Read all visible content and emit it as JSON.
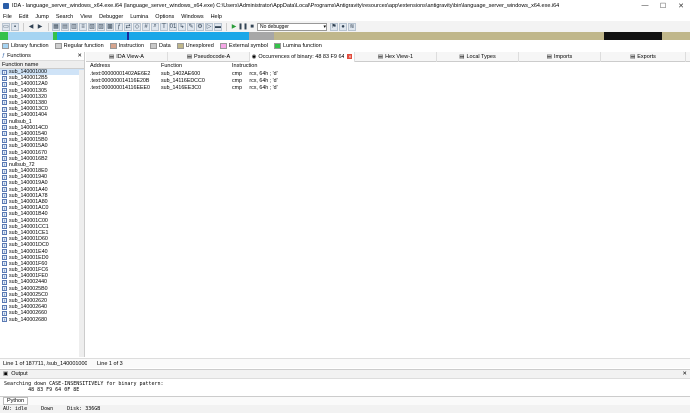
{
  "window": {
    "title": "IDA - language_server_windows_x64.exe.i64 (language_server_windows_x64.exe) C:\\Users\\Administrator\\AppData\\Local\\Programs\\Antigravity\\resources\\app\\extensions\\antigravity\\bin\\language_server_windows_x64.exe.i64",
    "minimize": "—",
    "maximize": "☐",
    "close": "✕"
  },
  "menu": [
    "File",
    "Edit",
    "Jump",
    "Search",
    "View",
    "Debugger",
    "Lumina",
    "Options",
    "Windows",
    "Help"
  ],
  "toolbar": {
    "debugger_select": "No debugger"
  },
  "legend": [
    {
      "label": "Library function",
      "color": "#a6d4f2"
    },
    {
      "label": "Regular function",
      "color": "#cfcfcf"
    },
    {
      "label": "Instruction",
      "color": "#d6a58f"
    },
    {
      "label": "Data",
      "color": "#c8c8c8"
    },
    {
      "label": "Unexplored",
      "color": "#c0b78b"
    },
    {
      "label": "External symbol",
      "color": "#f5a7e6"
    },
    {
      "label": "Lumina function",
      "color": "#35c14a"
    }
  ],
  "functions_pane": {
    "title": "Functions",
    "close": "✕",
    "column": "Function name",
    "icon": "f",
    "items": [
      "sub_140001000",
      "sub_1400012B5",
      "sub_1400012A0",
      "sub_140001305",
      "sub_140001320",
      "sub_140001380",
      "sub_1400013C0",
      "sub_140001404",
      "nullsub_1",
      "sub_1400014C0",
      "sub_140001540",
      "sub_1400015B0",
      "sub_1400015A0",
      "sub_140001670",
      "sub_1400016B2",
      "nullsub_72",
      "sub_1400018E0",
      "sub_140001940",
      "sub_1400019A0",
      "sub_140001A40",
      "sub_140001A78",
      "sub_140001A80",
      "sub_140001AC0",
      "sub_140001B40",
      "sub_140001C00",
      "sub_140001CC1",
      "sub_140001CE1",
      "sub_140001D60",
      "sub_140001DC0",
      "sub_140001E40",
      "sub_140001ED0",
      "sub_140001F60",
      "sub_140001FC6",
      "sub_140001FE0",
      "sub_140002440",
      "sub_1400025B0",
      "sub_1400025C0",
      "sub_140002620",
      "sub_140002640",
      "sub_140002660",
      "sub_140002680"
    ]
  },
  "status_line": {
    "left": "Line 1 of 187711, /sub_140001000",
    "right": "Line 1 of 3"
  },
  "tabs": [
    {
      "label": "IDA View-A",
      "icon": "▤",
      "closable": false
    },
    {
      "label": "Pseudocode-A",
      "icon": "▤",
      "closable": false
    },
    {
      "label": "Occurrences of binary: 48 83 F9 64 0F 8E",
      "icon": "◉",
      "closable": true
    },
    {
      "label": "Hex View-1",
      "icon": "▤",
      "closable": false
    },
    {
      "label": "Local Types",
      "icon": "▤",
      "closable": false
    },
    {
      "label": "Imports",
      "icon": "▤",
      "closable": false
    },
    {
      "label": "Exports",
      "icon": "▤",
      "closable": false
    }
  ],
  "results": {
    "columns": [
      "Address",
      "Function",
      "Instruction"
    ],
    "rows": [
      [
        ".text:00000001402AE6E2",
        "sub_1402AE600",
        "cmp     rcx, 64h ; 'd'"
      ],
      [
        ".text:000000014116E20B",
        "sub_14116EDCC0",
        "cmp     rcx, 64h ; 'd'"
      ],
      [
        ".text:000000014116EEE0",
        "sub_1416EE3C0",
        "cmp     rcx, 64h ; 'd'"
      ]
    ]
  },
  "output": {
    "title": "Output",
    "close": "✕",
    "lines": [
      "Searching down CASE-INSENSITIVELY for binary pattern:",
      "        48 83 F9 64 0F 8E"
    ],
    "python_tab": "Python",
    "status": {
      "au": "AU:  idle",
      "dir": "Down",
      "disk": "Disk: 336GB"
    }
  }
}
